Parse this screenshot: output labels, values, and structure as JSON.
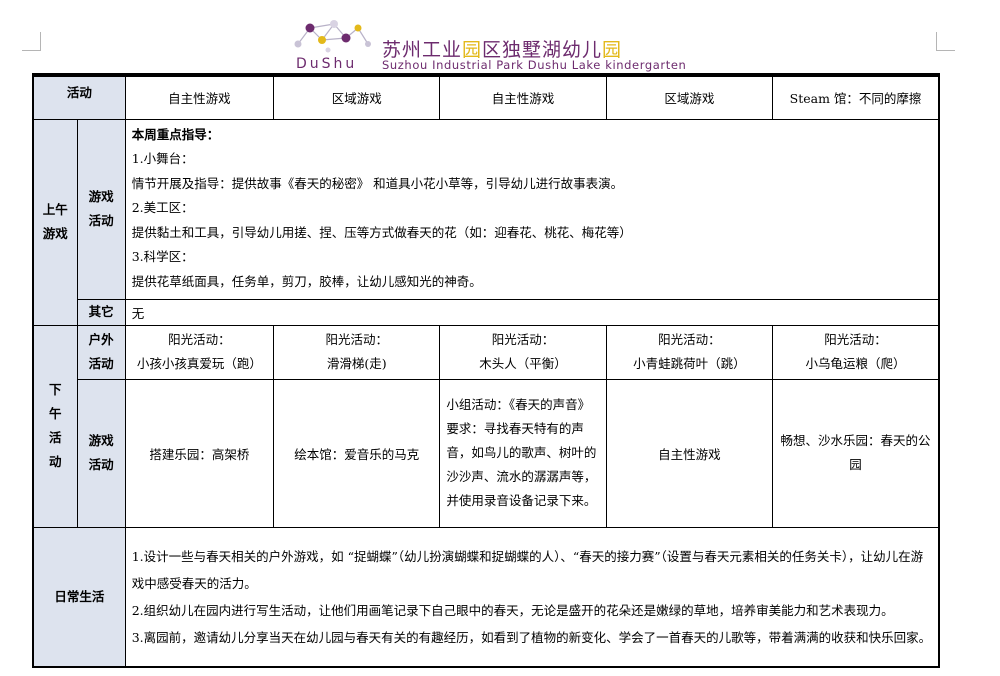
{
  "header": {
    "logo_text": "DuShu",
    "school_name_cn_a": "苏州工业",
    "school_name_cn_b": "园",
    "school_name_cn_c": "区独墅湖幼儿",
    "school_name_cn_d": "园",
    "school_name_en": "Suzhou Industrial Park Dushu Lake kindergarten",
    "colors": {
      "brand_purple": "#6d2b6e",
      "brand_yellow": "#e3b91a",
      "header_cell_bg": "#dde3ee"
    }
  },
  "table": {
    "row_activity": {
      "label": "活动",
      "cols": [
        "自主性游戏",
        "区域游戏",
        "自主性游戏",
        "区域游戏",
        "Steam 馆：不同的摩擦"
      ]
    },
    "morning": {
      "label": "上午游戏",
      "sub_label": "游戏活动",
      "lines": [
        "本周重点指导：",
        "1.小舞台：",
        "情节开展及指导：提供故事《春天的秘密》 和道具小花小草等，引导幼儿进行故事表演。",
        "2.美工区：",
        "提供黏土和工具，引导幼儿用搓、捏、压等方式做春天的花（如：迎春花、桃花、梅花等）",
        "3.科学区：",
        "提供花草纸面具，任务单，剪刀，胶棒，让幼儿感知光的神奇。"
      ],
      "other_label": "其它",
      "other_value": "无"
    },
    "afternoon": {
      "label": "下午活动",
      "outdoor_label": "户外活动",
      "outdoor": [
        {
          "title": "阳光活动：",
          "name": "小孩小孩真爱玩（跑）"
        },
        {
          "title": "阳光活动：",
          "name": "滑滑梯(走)"
        },
        {
          "title": "阳光活动：",
          "name": "木头人（平衡）"
        },
        {
          "title": "阳光活动：",
          "name": "小青蛙跳荷叶（跳）"
        },
        {
          "title": "阳光活动：",
          "name": "小乌龟运粮（爬）"
        }
      ],
      "game_label": "游戏活动",
      "games": [
        "搭建乐园：高架桥",
        "绘本馆：爱音乐的马克",
        "小组活动：《春天的声音》要求：寻找春天特有的声音，如鸟儿的歌声、树叶的沙沙声、流水的潺潺声等，并使用录音设备记录下来。",
        "自主性游戏",
        "畅想、沙水乐园：春天的公园"
      ]
    },
    "daily": {
      "label": "日常生活",
      "items": [
        "1.设计一些与春天相关的户外游戏，如 “捉蝴蝶”（幼儿扮演蝴蝶和捉蝴蝶的人）、“春天的接力赛”（设置与春天元素相关的任务关卡），让幼儿在游戏中感受春天的活力。",
        "2.组织幼儿在园内进行写生活动，让他们用画笔记录下自己眼中的春天，无论是盛开的花朵还是嫩绿的草地，培养审美能力和艺术表现力。",
        "3.离园前，邀请幼儿分享当天在幼儿园与春天有关的有趣经历，如看到了植物的新变化、学会了一首春天的儿歌等，带着满满的收获和快乐回家。"
      ]
    }
  }
}
